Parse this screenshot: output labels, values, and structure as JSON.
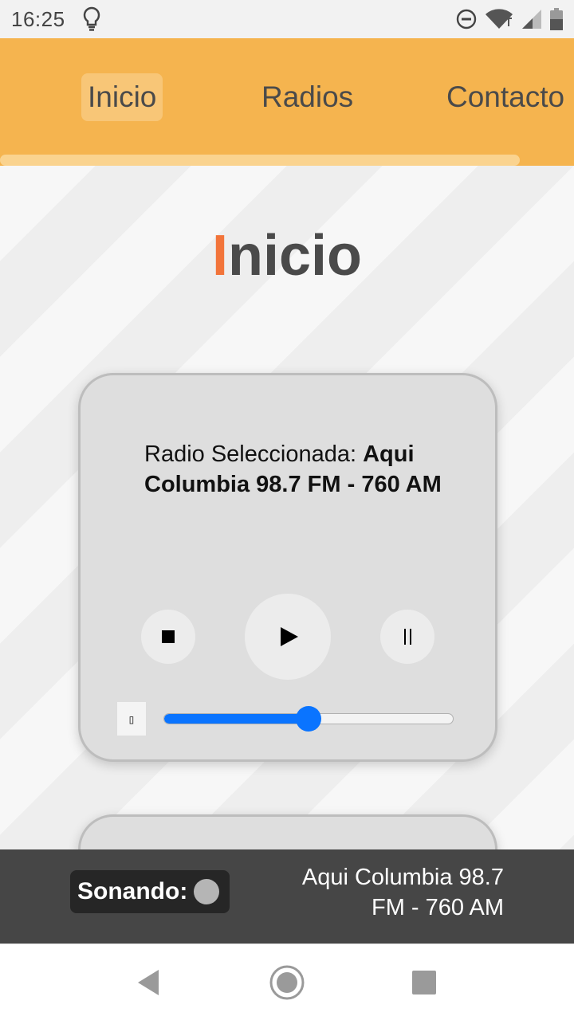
{
  "status_bar": {
    "time": "16:25",
    "icons": [
      "lightbulb-icon",
      "do-not-disturb-icon",
      "wifi-icon",
      "signal-icon",
      "battery-icon"
    ]
  },
  "nav": {
    "items": [
      {
        "label": "Inicio",
        "active": true
      },
      {
        "label": "Radios",
        "active": false
      },
      {
        "label": "Contacto",
        "active": false
      }
    ],
    "colors": {
      "background": "#f5b44f",
      "active": "#f8c677"
    }
  },
  "page": {
    "title_first_letter": "I",
    "title_rest": "nicio",
    "accent_color": "#f2743a"
  },
  "player": {
    "label": "Radio Seleccionada: ",
    "station": "Aqui Columbia 98.7 FM - 760 AM",
    "controls": [
      "stop-icon",
      "play-icon",
      "pause-icon"
    ],
    "volume_fraction": 0.5,
    "volume_icon": "▯",
    "slider_color": "#0a74ff"
  },
  "now_playing": {
    "label": "Sonando:",
    "station": "Aqui Columbia 98.7 FM - 760 AM"
  },
  "android_nav": [
    "back-icon",
    "home-icon",
    "recents-icon"
  ]
}
